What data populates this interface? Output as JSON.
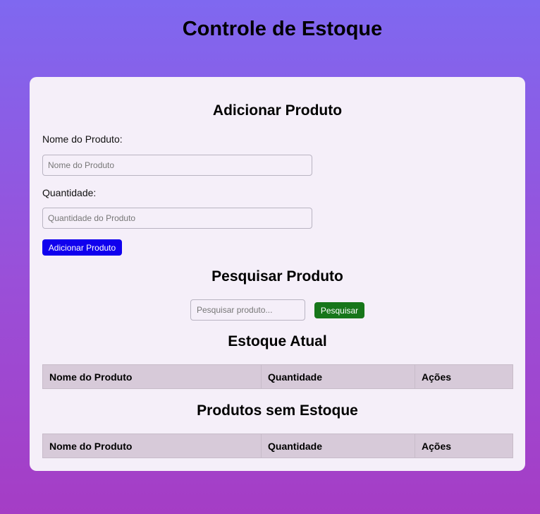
{
  "header": {
    "title": "Controle de Estoque"
  },
  "add_product": {
    "title": "Adicionar Produto",
    "name_label": "Nome do Produto:",
    "name_placeholder": "Nome do Produto",
    "name_value": "",
    "quantity_label": "Quantidade:",
    "quantity_placeholder": "Quantidade do Produto",
    "quantity_value": "",
    "submit_label": "Adicionar Produto"
  },
  "search": {
    "title": "Pesquisar Produto",
    "placeholder": "Pesquisar produto...",
    "value": "",
    "button_label": "Pesquisar"
  },
  "current_stock": {
    "title": "Estoque Atual",
    "columns": [
      "Nome do Produto",
      "Quantidade",
      "Ações"
    ],
    "rows": []
  },
  "out_of_stock": {
    "title": "Produtos sem Estoque",
    "columns": [
      "Nome do Produto",
      "Quantidade",
      "Ações"
    ],
    "rows": []
  },
  "colors": {
    "add_button": "#1000ee",
    "search_button": "#17761a",
    "card_background": "#f5eff9",
    "table_header": "#d7cad9"
  }
}
